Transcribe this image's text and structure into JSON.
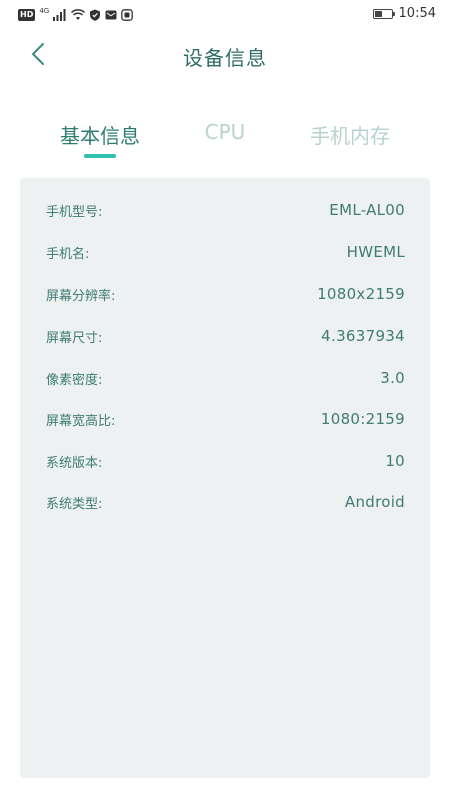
{
  "status_bar": {
    "hd": "HD",
    "network": "4G",
    "time": "10:54",
    "icons": [
      "signal-icon",
      "wifi-icon",
      "shield-icon",
      "mail-icon",
      "app-icon",
      "battery-icon"
    ],
    "battery_level": 0.4
  },
  "header": {
    "title": "设备信息",
    "back_icon": "chevron-left-icon"
  },
  "tabs": [
    {
      "label": "基本信息",
      "active": true
    },
    {
      "label": "CPU",
      "active": false
    },
    {
      "label": "手机内存",
      "active": false
    }
  ],
  "info_rows": [
    {
      "label": "手机型号:",
      "value": "EML-AL00"
    },
    {
      "label": "手机名:",
      "value": "HWEML"
    },
    {
      "label": "屏幕分辨率:",
      "value": "1080x2159"
    },
    {
      "label": "屏幕尺寸:",
      "value": "4.3637934"
    },
    {
      "label": "像素密度:",
      "value": "3.0"
    },
    {
      "label": "屏幕宽高比:",
      "value": "1080:2159"
    },
    {
      "label": "系统版本:",
      "value": "10"
    },
    {
      "label": "系统类型:",
      "value": "Android"
    }
  ],
  "colors": {
    "accent": "#2fc1ad",
    "text_primary": "#2f7d72",
    "tab_inactive": "#b7d3cf",
    "card_bg": "#eef1f1"
  }
}
